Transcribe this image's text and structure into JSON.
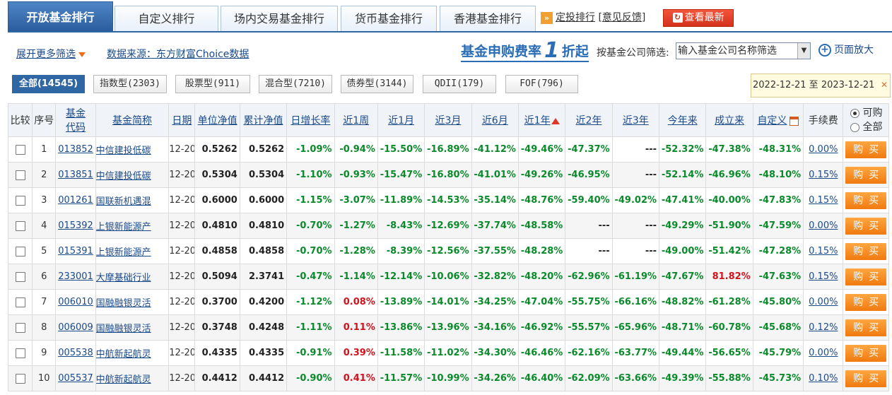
{
  "tabs": [
    {
      "label": "开放基金排行",
      "active": true
    },
    {
      "label": "自定义排行",
      "active": false
    },
    {
      "label": "场内交易基金排行",
      "active": false
    },
    {
      "label": "货币基金排行",
      "active": false
    },
    {
      "label": "香港基金排行",
      "active": false
    }
  ],
  "top_links": {
    "dingtou": "定投排行",
    "bracket_open": "[",
    "feedback": "意见反馈",
    "bracket_close": "]",
    "refresh": "查看最新"
  },
  "info": {
    "expand_filter": "展开更多筛选",
    "data_source": "数据来源：东方财富Choice数据",
    "promo_a": "基金申购费率",
    "promo_b": "1",
    "promo_c": "折起",
    "company_filter_label": "按基金公司筛选:",
    "company_select_value": "输入基金公司名称筛选",
    "zoom_label": "页面放大"
  },
  "types": [
    {
      "label": "全部(14545)",
      "active": true
    },
    {
      "label": "指数型(2303)",
      "active": false
    },
    {
      "label": "股票型(911)",
      "active": false
    },
    {
      "label": "混合型(7210)",
      "active": false
    },
    {
      "label": "债券型(3144)",
      "active": false
    },
    {
      "label": "QDII(179)",
      "active": false
    },
    {
      "label": "FOF(796)",
      "active": false
    }
  ],
  "date_range": "2022-12-21 至 2023-12-21",
  "headers": {
    "compare": "比较",
    "seq": "序号",
    "code_a": "基金",
    "code_b": "代码",
    "name": "基金简称",
    "date": "日期",
    "nav": "单位净值",
    "acc_nav": "累计净值",
    "daily": "日增长率",
    "w1": "近1周",
    "m1": "近1月",
    "m3": "近3月",
    "m6": "近6月",
    "y1": "近1年",
    "y2": "近2年",
    "y3": "近3年",
    "ytd": "今年来",
    "since": "成立来",
    "custom": "自定义",
    "fee": "手续费",
    "radio_buyable": "可购",
    "radio_all": "全部"
  },
  "buy_label": "购买",
  "rows": [
    {
      "seq": "1",
      "code": "013852",
      "name": "中信建投低碳",
      "date": "12-20",
      "nav": "0.5262",
      "acc": "0.5262",
      "daily": "-1.09%",
      "w1": "-0.94%",
      "m1": "-15.50%",
      "m3": "-16.89%",
      "m6": "-41.12%",
      "y1": "-49.46%",
      "y2": "-47.37%",
      "y3": "---",
      "ytd": "-52.32%",
      "since": "-47.38%",
      "custom": "-48.31%",
      "fee": "0.00%"
    },
    {
      "seq": "2",
      "code": "013851",
      "name": "中信建投低碳",
      "date": "12-20",
      "nav": "0.5304",
      "acc": "0.5304",
      "daily": "-1.10%",
      "w1": "-0.93%",
      "m1": "-15.47%",
      "m3": "-16.80%",
      "m6": "-41.01%",
      "y1": "-49.26%",
      "y2": "-46.95%",
      "y3": "---",
      "ytd": "-52.14%",
      "since": "-46.96%",
      "custom": "-48.10%",
      "fee": "0.15%"
    },
    {
      "seq": "3",
      "code": "001261",
      "name": "国联新机遇混",
      "date": "12-20",
      "nav": "0.6000",
      "acc": "0.6000",
      "daily": "-1.15%",
      "w1": "-3.07%",
      "m1": "-11.89%",
      "m3": "-14.53%",
      "m6": "-35.14%",
      "y1": "-48.76%",
      "y2": "-59.40%",
      "y3": "-49.02%",
      "ytd": "-47.41%",
      "since": "-40.00%",
      "custom": "-47.83%",
      "fee": "0.15%"
    },
    {
      "seq": "4",
      "code": "015392",
      "name": "上银新能源产",
      "date": "12-20",
      "nav": "0.4810",
      "acc": "0.4810",
      "daily": "-0.70%",
      "w1": "-1.27%",
      "m1": "-8.43%",
      "m3": "-12.69%",
      "m6": "-37.74%",
      "y1": "-48.58%",
      "y2": "---",
      "y3": "---",
      "ytd": "-49.29%",
      "since": "-51.90%",
      "custom": "-47.59%",
      "fee": "0.00%"
    },
    {
      "seq": "5",
      "code": "015391",
      "name": "上银新能源产",
      "date": "12-20",
      "nav": "0.4858",
      "acc": "0.4858",
      "daily": "-0.70%",
      "w1": "-1.28%",
      "m1": "-8.39%",
      "m3": "-12.56%",
      "m6": "-37.55%",
      "y1": "-48.28%",
      "y2": "---",
      "y3": "---",
      "ytd": "-49.00%",
      "since": "-51.42%",
      "custom": "-47.28%",
      "fee": "0.15%"
    },
    {
      "seq": "6",
      "code": "233001",
      "name": "大摩基础行业",
      "date": "12-20",
      "nav": "0.5094",
      "acc": "2.3741",
      "daily": "-0.47%",
      "w1": "-1.14%",
      "m1": "-12.14%",
      "m3": "-10.06%",
      "m6": "-32.82%",
      "y1": "-48.20%",
      "y2": "-62.96%",
      "y3": "-61.19%",
      "ytd": "-47.67%",
      "since": "81.82%",
      "custom": "-47.63%",
      "fee": "0.15%"
    },
    {
      "seq": "7",
      "code": "006010",
      "name": "国融融银灵活",
      "date": "12-20",
      "nav": "0.3700",
      "acc": "0.4200",
      "daily": "-1.12%",
      "w1": "0.08%",
      "m1": "-13.89%",
      "m3": "-14.01%",
      "m6": "-34.25%",
      "y1": "-47.04%",
      "y2": "-55.75%",
      "y3": "-66.16%",
      "ytd": "-48.82%",
      "since": "-61.28%",
      "custom": "-45.80%",
      "fee": "0.00%"
    },
    {
      "seq": "8",
      "code": "006009",
      "name": "国融融银灵活",
      "date": "12-20",
      "nav": "0.3748",
      "acc": "0.4248",
      "daily": "-1.11%",
      "w1": "0.11%",
      "m1": "-13.86%",
      "m3": "-13.96%",
      "m6": "-34.16%",
      "y1": "-46.92%",
      "y2": "-55.57%",
      "y3": "-65.96%",
      "ytd": "-48.71%",
      "since": "-60.78%",
      "custom": "-45.68%",
      "fee": "0.12%"
    },
    {
      "seq": "9",
      "code": "005538",
      "name": "中航新起航灵",
      "date": "12-20",
      "nav": "0.4335",
      "acc": "0.4335",
      "daily": "-0.91%",
      "w1": "0.39%",
      "m1": "-11.58%",
      "m3": "-11.02%",
      "m6": "-34.30%",
      "y1": "-46.46%",
      "y2": "-62.16%",
      "y3": "-63.77%",
      "ytd": "-49.44%",
      "since": "-56.65%",
      "custom": "-45.79%",
      "fee": "0.00%"
    },
    {
      "seq": "10",
      "code": "005537",
      "name": "中航新起航灵",
      "date": "12-20",
      "nav": "0.4412",
      "acc": "0.4412",
      "daily": "-0.90%",
      "w1": "0.41%",
      "m1": "-11.57%",
      "m3": "-10.99%",
      "m6": "-34.26%",
      "y1": "-46.40%",
      "y2": "-62.09%",
      "y3": "-63.66%",
      "ytd": "-49.39%",
      "since": "-55.88%",
      "custom": "-45.73%",
      "fee": "0.10%"
    }
  ],
  "colors": {
    "tab_active": "#2f66a4",
    "negative": "#0a8a2a",
    "positive": "#d0141c",
    "buy_button": "#f07a10",
    "refresh_button": "#d4321b"
  }
}
